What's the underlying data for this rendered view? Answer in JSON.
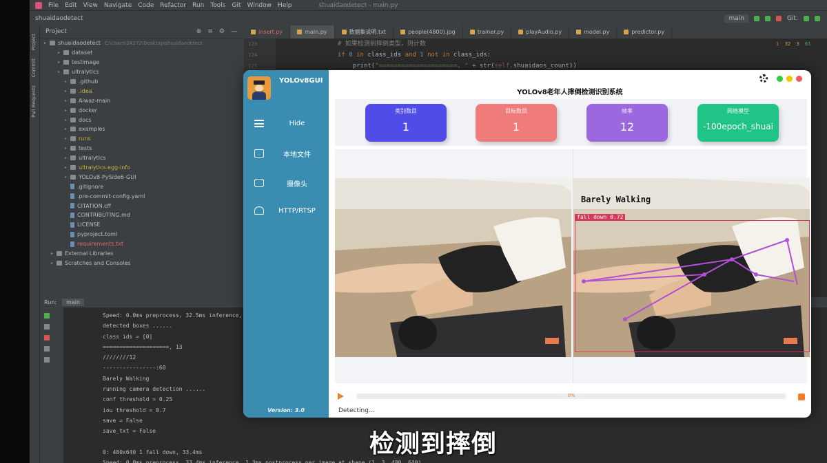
{
  "ide": {
    "menu": [
      "File",
      "Edit",
      "View",
      "Navigate",
      "Code",
      "Refactor",
      "Run",
      "Tools",
      "Git",
      "Window",
      "Help"
    ],
    "window_title": "shuaidaodetect - main.py",
    "breadcrumb": "shuaidaodetect",
    "branch": "main",
    "git_label": "Git:",
    "project_label": "Project",
    "tree": [
      {
        "label": "shuaidaodetect",
        "note": "C:\\Users\\24272\\Desktop\\shuaidaodetect",
        "type": "folder",
        "indent": 0,
        "style": ""
      },
      {
        "label": "dataset",
        "type": "folder",
        "indent": 2,
        "style": ""
      },
      {
        "label": "testimage",
        "type": "folder",
        "indent": 2,
        "style": ""
      },
      {
        "label": "ultralytics",
        "type": "folder",
        "indent": 2,
        "style": ""
      },
      {
        "label": ".github",
        "type": "folder",
        "indent": 3,
        "style": ""
      },
      {
        "label": ".idea",
        "type": "folder",
        "indent": 3,
        "style": "yellow"
      },
      {
        "label": "Aiwaz-main",
        "type": "folder",
        "indent": 3,
        "style": ""
      },
      {
        "label": "docker",
        "type": "folder",
        "indent": 3,
        "style": ""
      },
      {
        "label": "docs",
        "type": "folder",
        "indent": 3,
        "style": ""
      },
      {
        "label": "examples",
        "type": "folder",
        "indent": 3,
        "style": ""
      },
      {
        "label": "runs",
        "type": "folder",
        "indent": 3,
        "style": "yellow"
      },
      {
        "label": "tests",
        "type": "folder",
        "indent": 3,
        "style": ""
      },
      {
        "label": "ultralytics",
        "type": "folder",
        "indent": 3,
        "style": ""
      },
      {
        "label": "ultralytics.egg-info",
        "type": "folder",
        "indent": 3,
        "style": "yellow"
      },
      {
        "label": "YOLOv8-PySide6-GUI",
        "type": "folder",
        "indent": 3,
        "style": ""
      },
      {
        "label": ".gitignore",
        "type": "file",
        "indent": 3,
        "style": ""
      },
      {
        "label": ".pre-commit-config.yaml",
        "type": "file",
        "indent": 3,
        "style": ""
      },
      {
        "label": "CITATION.cff",
        "type": "file",
        "indent": 3,
        "style": ""
      },
      {
        "label": "CONTRIBUTING.md",
        "type": "file",
        "indent": 3,
        "style": ""
      },
      {
        "label": "LICENSE",
        "type": "file",
        "indent": 3,
        "style": ""
      },
      {
        "label": "pyproject.toml",
        "type": "file",
        "indent": 3,
        "style": ""
      },
      {
        "label": "requirements.txt",
        "type": "file",
        "indent": 3,
        "style": "red"
      },
      {
        "label": "External Libraries",
        "type": "folder",
        "indent": 1,
        "style": ""
      },
      {
        "label": "Scratches and Consoles",
        "type": "folder",
        "indent": 1,
        "style": ""
      }
    ],
    "tabs": [
      {
        "label": "insert.py",
        "active": false,
        "style": "red"
      },
      {
        "label": "main.py",
        "active": true,
        "style": ""
      },
      {
        "label": "数据集说明.txt",
        "active": false,
        "style": ""
      },
      {
        "label": "people(4800).jpg",
        "active": false,
        "style": ""
      },
      {
        "label": "trainer.py",
        "active": false,
        "style": ""
      },
      {
        "label": "playAudio.py",
        "active": false,
        "style": ""
      },
      {
        "label": "model.py",
        "active": false,
        "style": ""
      },
      {
        "label": "predictor.py",
        "active": false,
        "style": ""
      }
    ],
    "gutter": [
      "123",
      "124",
      "125"
    ],
    "code_lines": [
      {
        "parts": [
          {
            "t": "# 如果检测到摔倒类型，则计数",
            "c": "cm"
          }
        ]
      },
      {
        "parts": [
          {
            "t": "if ",
            "c": "kw"
          },
          {
            "t": "0 ",
            "c": "num"
          },
          {
            "t": "in ",
            "c": "kw"
          },
          {
            "t": "class_ids ",
            "c": ""
          },
          {
            "t": "and ",
            "c": "kw"
          },
          {
            "t": "1 ",
            "c": "num"
          },
          {
            "t": "not in ",
            "c": "kw"
          },
          {
            "t": "class_ids:",
            "c": ""
          }
        ]
      },
      {
        "parts": [
          {
            "t": "    print(",
            "c": ""
          },
          {
            "t": "\"=====================, \"",
            "c": "str"
          },
          {
            "t": " + str(",
            "c": ""
          },
          {
            "t": "self",
            "c": "slf"
          },
          {
            "t": ".shuaidaos_count))",
            "c": ""
          }
        ]
      }
    ],
    "inspections": {
      "warnings": "1",
      "weak": "32",
      "typos": "3",
      "ok": "61"
    },
    "run_tab": "Run:",
    "run_config": "main",
    "log": [
      "Speed: 0.0ms preprocess, 32.5ms inference, 0",
      "detected boxes ......",
      "class ids =  [0]",
      "====================, 13",
      "////////12",
      "----------------:60",
      "Barely Walking",
      "running camera detection ......",
      "conf threshold =  0.25",
      "iou threshold =  0.7",
      "save =  False",
      "save_txt =  False",
      "",
      "0: 480x640 1 fall down, 33.4ms",
      "Speed: 0.0ms preprocess, 33.4ms inference, 1.3ms postprocess per image at shape (1, 3, 480, 640)"
    ]
  },
  "app": {
    "brand": "YOLOv8GUI",
    "title": "YOLOv8老年人摔倒检测识别系统",
    "nav": [
      {
        "label": "Hide",
        "icon": "menu-icon"
      },
      {
        "label": "本地文件",
        "icon": "folder-icon"
      },
      {
        "label": "摄像头",
        "icon": "camera-icon"
      },
      {
        "label": "HTTP/RTSP",
        "icon": "network-icon"
      }
    ],
    "version": "Version: 3.0",
    "cards": [
      {
        "title": "类别数目",
        "value": "1",
        "color": "#4f4ce8"
      },
      {
        "title": "目标数目",
        "value": "1",
        "color": "#f07b7b"
      },
      {
        "title": "帧率",
        "value": "12",
        "color": "#9b68e0"
      },
      {
        "title": "网络模型",
        "value": "-100epoch_shuai",
        "color": "#1fc486"
      }
    ],
    "detection": {
      "overlay_text": "Barely Walking",
      "box_label": "fall down 0.72"
    },
    "progress": {
      "value": 0,
      "label": "0%"
    },
    "status": "Detecting...",
    "window_controls": [
      "#2ecc40",
      "#f5c400",
      "#f05a5a"
    ]
  },
  "subtitle": "检测到摔倒"
}
